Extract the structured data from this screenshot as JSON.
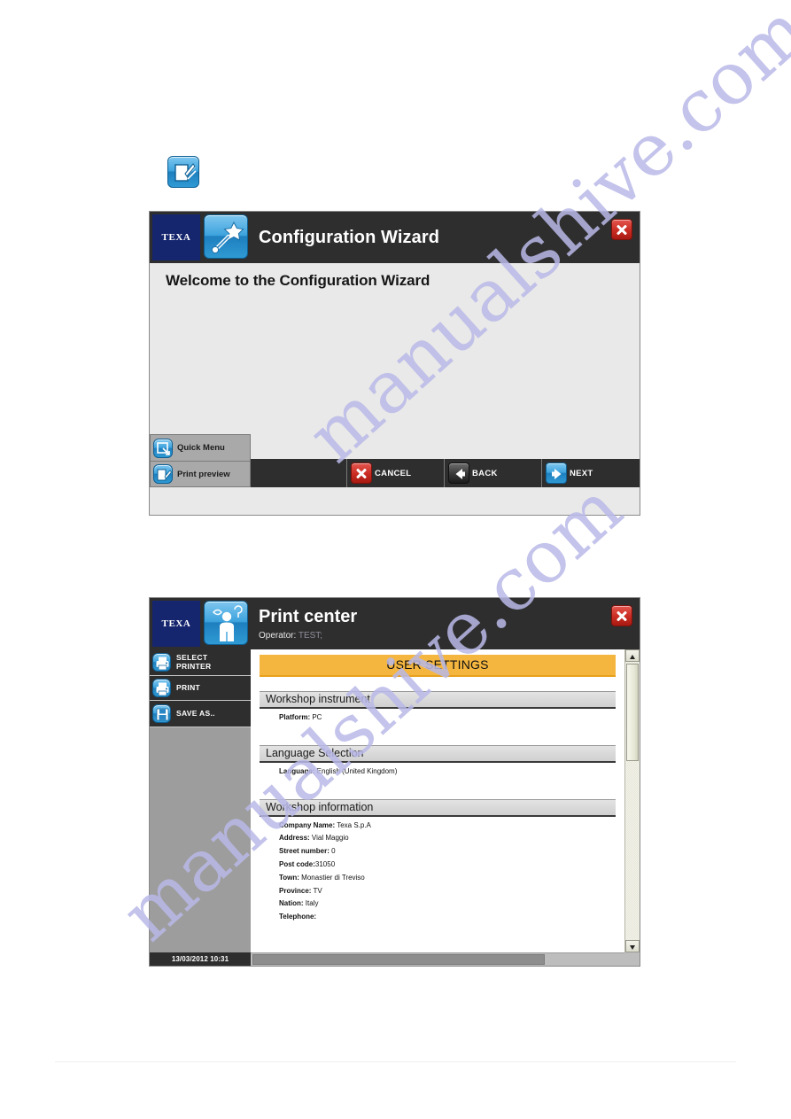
{
  "watermark": {
    "line1": "manualshive.com",
    "line2": "manualshive.com",
    "color": "#b9b9e8"
  },
  "lead_icon": {
    "name": "print-preview-icon"
  },
  "wizard_dialog": {
    "brand": "TEXA",
    "title": "Configuration Wizard",
    "close_label": "×",
    "welcome_heading": "Welcome to the Configuration Wizard",
    "side_buttons": [
      {
        "label": "Quick Menu",
        "icon": "quick-menu-icon"
      },
      {
        "label": "Print preview",
        "icon": "print-preview-icon"
      }
    ],
    "footer_buttons": [
      {
        "label": "CANCEL",
        "icon": "cancel-x-icon",
        "color": "#c92c22"
      },
      {
        "label": "BACK",
        "icon": "arrow-left-icon",
        "color": "#3a3a3a"
      },
      {
        "label": "NEXT",
        "icon": "arrow-right-icon",
        "color": "#3da3dd"
      }
    ]
  },
  "print_dialog": {
    "brand": "TEXA",
    "title": "Print center",
    "operator_label": "Operator:",
    "operator_value": "TEST;",
    "close_label": "×",
    "sidebar": [
      {
        "label_line1": "SELECT",
        "label_line2": "PRINTER",
        "icon": "printer-icon"
      },
      {
        "label_line1": "PRINT",
        "label_line2": "",
        "icon": "printer-icon"
      },
      {
        "label_line1": "SAVE AS..",
        "label_line2": "",
        "icon": "save-disk-icon"
      }
    ],
    "status_timestamp": "13/03/2012 10:31",
    "document": {
      "banner": "USER SETTINGS",
      "sections": [
        {
          "heading": "Workshop instrument",
          "fields": [
            {
              "label": "Platform:",
              "value": " PC"
            }
          ]
        },
        {
          "heading": "Language Selection",
          "fields": [
            {
              "label": "Language:",
              "value": " English (United Kingdom)"
            }
          ]
        },
        {
          "heading": "Workshop information",
          "fields": [
            {
              "label": "Company Name:",
              "value": " Texa S.p.A"
            },
            {
              "label": "Address:",
              "value": " Vial Maggio"
            },
            {
              "label": "Street number:",
              "value": " 0"
            },
            {
              "label": "Post code:",
              "value": "31050"
            },
            {
              "label": "Town:",
              "value": " Monastier di Treviso"
            },
            {
              "label": "Province:",
              "value": " TV"
            },
            {
              "label": "Nation:",
              "value": " Italy"
            },
            {
              "label": "Telephone:",
              "value": ""
            }
          ]
        }
      ]
    }
  }
}
